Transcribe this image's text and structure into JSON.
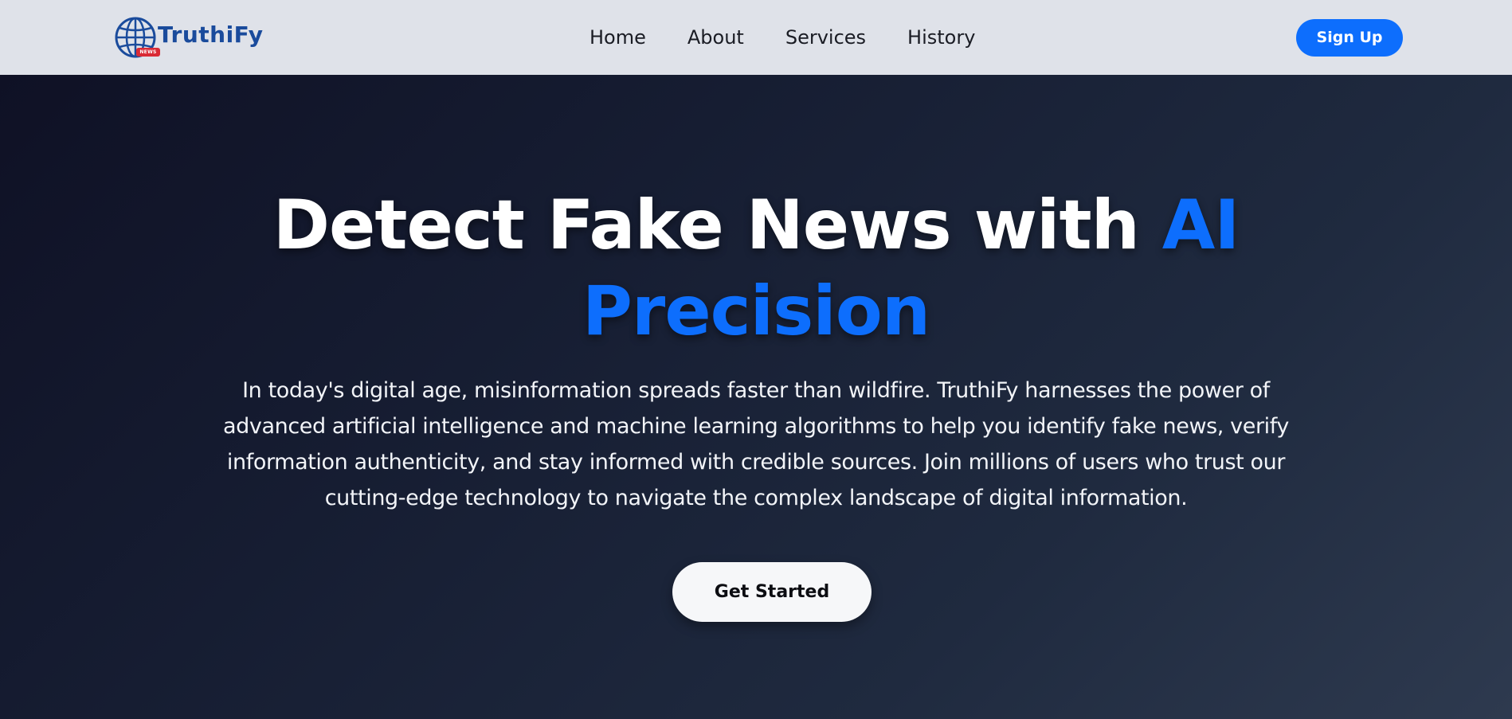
{
  "brand": {
    "name": "TruthiFy",
    "badge": "NEWS",
    "colors": {
      "logo_text": "#1a4b9c",
      "badge": "#d92a35"
    }
  },
  "nav": {
    "links": [
      {
        "label": "Home"
      },
      {
        "label": "About"
      },
      {
        "label": "Services"
      },
      {
        "label": "History"
      }
    ],
    "signup_label": "Sign Up"
  },
  "hero": {
    "title_main": "Detect Fake News with ",
    "title_accent_1": "AI",
    "title_accent_2": "Precision",
    "description": "In today's digital age, misinformation spreads faster than wildfire. TruthiFy harnesses the power of advanced artificial intelligence and machine learning algorithms to help you identify fake news, verify information authenticity, and stay informed with credible sources. Join millions of users who trust our cutting-edge technology to navigate the complex landscape of digital information.",
    "cta_label": "Get Started"
  },
  "colors": {
    "navbar_bg": "#dfe2e9",
    "accent": "#0d6efd",
    "hero_bg_start": "#0f1125",
    "hero_bg_end": "#2e3a4f",
    "cta_bg": "#f6f7f9"
  },
  "icons": {
    "logo": "globe-icon"
  }
}
